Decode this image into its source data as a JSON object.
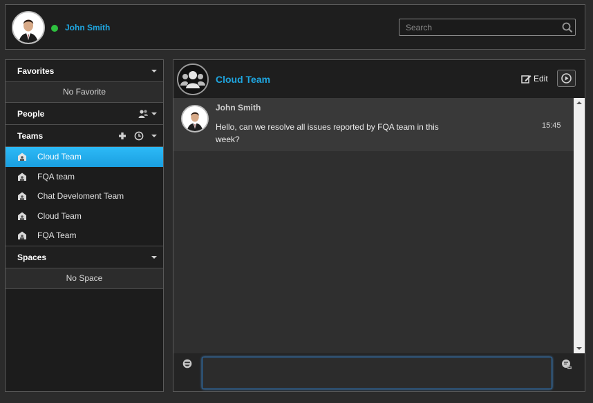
{
  "user": {
    "name": "John Smith",
    "status_color": "#2ec13f"
  },
  "search": {
    "placeholder": "Search"
  },
  "sidebar": {
    "favorites": {
      "title": "Favorites",
      "empty": "No Favorite"
    },
    "people": {
      "title": "People"
    },
    "teams": {
      "title": "Teams",
      "items": [
        {
          "label": "Cloud Team",
          "active": true
        },
        {
          "label": "FQA team"
        },
        {
          "label": "Chat Develoment Team"
        },
        {
          "label": "Cloud Team"
        },
        {
          "label": "FQA Team"
        }
      ]
    },
    "spaces": {
      "title": "Spaces",
      "empty": "No Space"
    }
  },
  "chat": {
    "title": "Cloud Team",
    "edit_label": "Edit",
    "messages": [
      {
        "sender": "John Smith",
        "text": "Hello, can we resolve all issues reported by FQA team in this week?",
        "time": "15:45"
      }
    ],
    "input_value": ""
  },
  "colors": {
    "accent": "#1fa6e0",
    "active_item": "#1aa6ea"
  }
}
